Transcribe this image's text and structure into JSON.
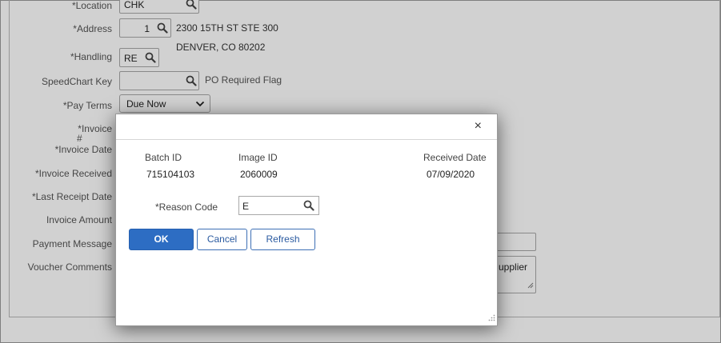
{
  "form": {
    "location_label": "*Location",
    "location_value": "CHK",
    "address_label": "*Address",
    "address_value": "1",
    "address_line1": "2300 15TH ST STE 300",
    "address_line2": "DENVER, CO  80202",
    "handling_label": "*Handling",
    "handling_value": "RE",
    "speedchart_label": "SpeedChart Key",
    "speedchart_value": "",
    "po_required_flag": "PO Required Flag",
    "pay_terms_label": "*Pay Terms",
    "pay_terms_value": "Due Now",
    "invoice_num_label_1": "*Invoice",
    "invoice_num_label_2": "#",
    "invoice_date_label": "*Invoice Date",
    "invoice_received_label": "*Invoice Received",
    "last_receipt_date_label": "*Last Receipt Date",
    "invoice_amount_label": "Invoice Amount",
    "payment_message_label": "Payment Message",
    "voucher_comments_label": "Voucher Comments",
    "voucher_comments_partial": "upplier"
  },
  "modal": {
    "close_glyph": "×",
    "batch_id_label": "Batch ID",
    "batch_id_value": "715104103",
    "image_id_label": "Image ID",
    "image_id_value": "2060009",
    "received_date_label": "Received Date",
    "received_date_value": "07/09/2020",
    "reason_code_label": "*Reason Code",
    "reason_code_value": "E",
    "ok_label": "OK",
    "cancel_label": "Cancel",
    "refresh_label": "Refresh"
  },
  "colors": {
    "primary_button": "#2d6dc3",
    "link_blue": "#2a5aa0",
    "overlay": "rgba(0,0,0,0.18)"
  },
  "icons": [
    "search-icon",
    "chevron-down-icon",
    "close-icon",
    "resize-grip-icon"
  ]
}
